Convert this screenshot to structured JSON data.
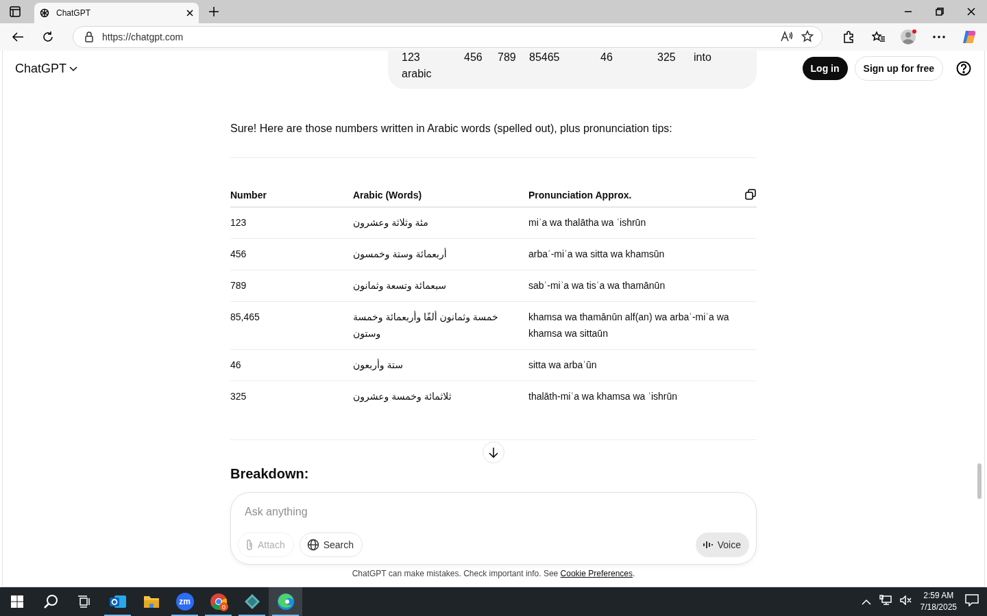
{
  "browser": {
    "tab": {
      "title": "ChatGPT",
      "selected": true
    },
    "url": "https://chatgpt.com"
  },
  "header": {
    "brand": "ChatGPT",
    "login": "Log in",
    "signup": "Sign up for free"
  },
  "user_message": {
    "words": [
      "123",
      "456",
      "789",
      "85465",
      "46",
      "325",
      "into",
      "arabic"
    ]
  },
  "reply": {
    "intro": "Sure! Here are those numbers written in Arabic words (spelled out), plus pronunciation tips:",
    "table": {
      "columns": [
        "Number",
        "Arabic (Words)",
        "Pronunciation Approx."
      ],
      "rows": [
        {
          "number": "123",
          "arabic": "مئة وثلاثة وعشرون",
          "pronunciation": "miʾa wa thalātha wa ʿishrūn"
        },
        {
          "number": "456",
          "arabic": "أربعمائة وستة وخمسون",
          "pronunciation": "arbaʿ-miʾa wa sitta wa khamsūn"
        },
        {
          "number": "789",
          "arabic": "سبعمائة وتسعة وثمانون",
          "pronunciation": "sabʿ-miʾa wa tisʿa wa thamānūn"
        },
        {
          "number": "85,465",
          "arabic": "خمسة وثمانون ألفًا وأربعمائة وخمسة وستون",
          "pronunciation": "khamsa wa thamānūn alf(an) wa arbaʿ-miʾa wa khamsa wa sittaūn"
        },
        {
          "number": "46",
          "arabic": "ستة وأربعون",
          "pronunciation": "sitta wa arbaʿūn"
        },
        {
          "number": "325",
          "arabic": "ثلاثمائة وخمسة وعشرون",
          "pronunciation": "thalāth-miʾa wa khamsa wa ʿishrūn"
        }
      ]
    },
    "next_heading": "Breakdown:"
  },
  "composer": {
    "placeholder": "Ask anything",
    "buttons": [
      {
        "label": "Attach",
        "kind": "attach",
        "disabled": true
      },
      {
        "label": "Search",
        "kind": "search",
        "disabled": false
      }
    ],
    "voice": "Voice"
  },
  "footnote": {
    "text": "ChatGPT can make mistakes. Check important info. See",
    "link": "Cookie Preferences",
    "end": "."
  },
  "taskbar": {
    "apps": [
      {
        "kind": "mail",
        "running": true,
        "selected": false
      },
      {
        "kind": "folder",
        "running": false,
        "selected": false
      },
      {
        "kind": "zoom",
        "label": "zm",
        "running": true,
        "selected": false
      },
      {
        "kind": "chrome",
        "badge": "0",
        "running": true,
        "selected": false
      },
      {
        "kind": "diamond",
        "running": true,
        "selected": false
      },
      {
        "kind": "edge",
        "running": true,
        "selected": true
      }
    ],
    "time": "2:59 AM",
    "date": "7/18/2025"
  }
}
